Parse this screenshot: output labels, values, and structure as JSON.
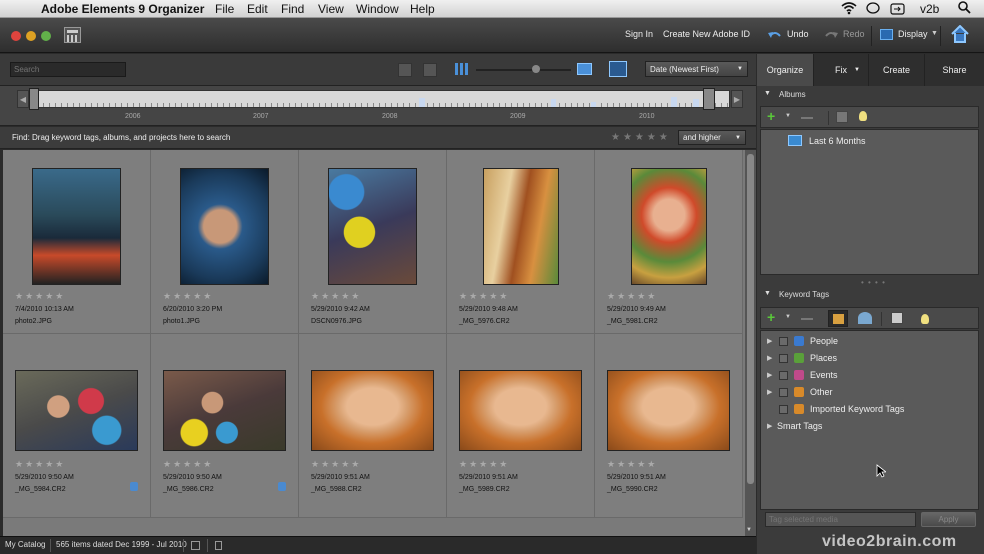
{
  "menubar": {
    "app_name": "Adobe Elements 9 Organizer",
    "menus": [
      "File",
      "Edit",
      "Find",
      "View",
      "Window",
      "Help"
    ],
    "right_user": "v2b"
  },
  "titlebar": {
    "sign_in": "Sign In",
    "create_id": "Create New Adobe ID",
    "undo": "Undo",
    "redo": "Redo",
    "display": "Display"
  },
  "toolbar": {
    "search_placeholder": "Search",
    "sort": "Date (Newest First)"
  },
  "timeline": {
    "years": [
      "2006",
      "2007",
      "2008",
      "2009",
      "2010"
    ]
  },
  "findbar": {
    "text": "Find: Drag keyword tags, albums, and projects here to search",
    "rating_filter": "and higher"
  },
  "photos": [
    {
      "date": "7/4/2010 10:13 AM",
      "file": "photo2.JPG"
    },
    {
      "date": "6/20/2010 3:20 PM",
      "file": "photo1.JPG"
    },
    {
      "date": "5/29/2010 9:42 AM",
      "file": "DSCN0976.JPG"
    },
    {
      "date": "5/29/2010 9:48 AM",
      "file": "_MG_5976.CR2"
    },
    {
      "date": "5/29/2010 9:49 AM",
      "file": "_MG_5981.CR2"
    },
    {
      "date": "5/29/2010 9:50 AM",
      "file": "_MG_5984.CR2"
    },
    {
      "date": "5/29/2010 9:50 AM",
      "file": "_MG_5986.CR2"
    },
    {
      "date": "5/29/2010 9:51 AM",
      "file": "_MG_5988.CR2"
    },
    {
      "date": "5/29/2010 9:51 AM",
      "file": "_MG_5989.CR2"
    },
    {
      "date": "5/29/2010 9:51 AM",
      "file": "_MG_5990.CR2"
    }
  ],
  "statusbar": {
    "catalog": "My Catalog",
    "count": "565 items dated Dec 1999 - Jul 2010"
  },
  "rpanel": {
    "tabs": [
      "Organize",
      "Fix",
      "Create",
      "Share"
    ],
    "albums_header": "Albums",
    "albums": [
      "Last 6 Months"
    ],
    "keyword_header": "Keyword Tags",
    "tags": [
      "People",
      "Places",
      "Events",
      "Other",
      "Imported Keyword Tags"
    ],
    "smart_tags": "Smart Tags",
    "tag_input_placeholder": "Tag selected media",
    "apply": "Apply"
  },
  "watermark": "video2brain.com"
}
